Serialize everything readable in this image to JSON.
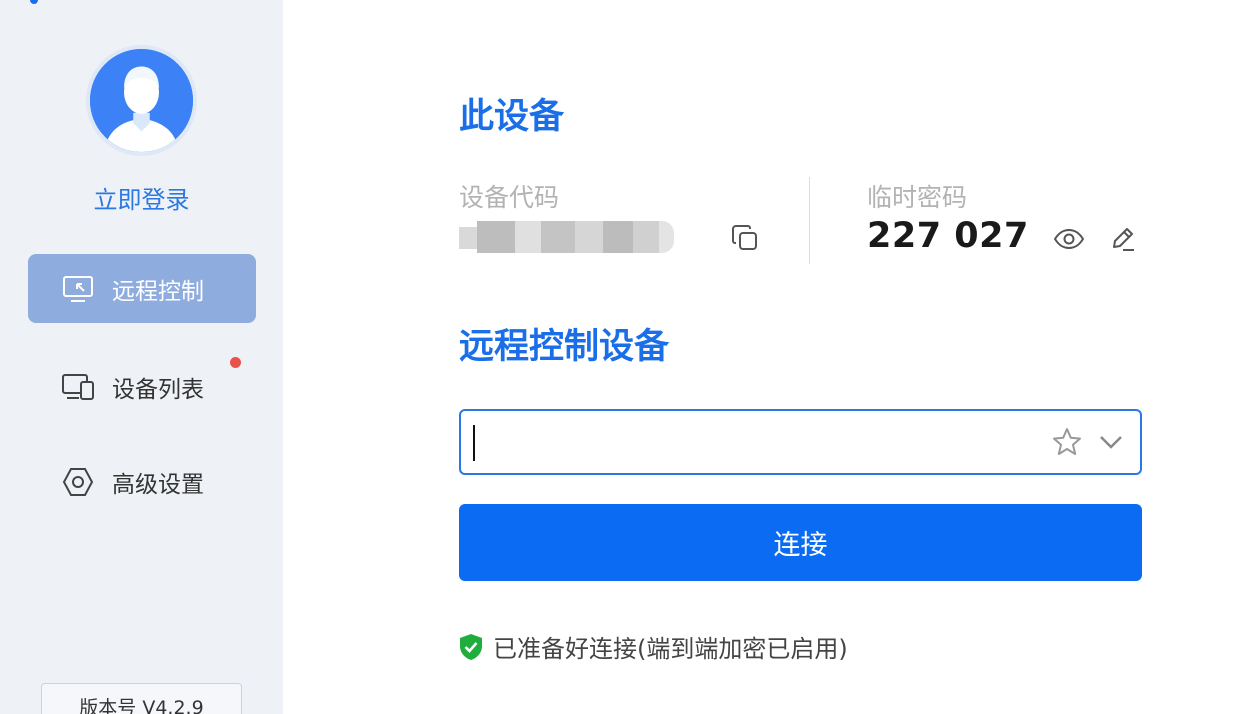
{
  "sidebar": {
    "login_label": "立即登录",
    "nav": [
      {
        "label": "远程控制",
        "icon": "monitor-remote-icon",
        "active": true
      },
      {
        "label": "设备列表",
        "icon": "devices-icon",
        "active": false,
        "has_badge": true
      },
      {
        "label": "高级设置",
        "icon": "hexagon-settings-icon",
        "active": false
      }
    ],
    "version": "版本号 V4.2.9"
  },
  "main": {
    "device_title": "此设备",
    "device_code_label": "设备代码",
    "temp_password_label": "临时密码",
    "temp_password": "227 027",
    "remote_title": "远程控制设备",
    "input_value": "",
    "connect_label": "连接",
    "status_text": "已准备好连接(端到端加密已启用)"
  },
  "colors": {
    "accent": "#1a6fe8",
    "button": "#0b6cf3",
    "sidebar_bg": "#eef1f6",
    "nav_active_bg": "#8facdf",
    "badge": "#e8524a",
    "status_ok": "#1fae3c"
  }
}
